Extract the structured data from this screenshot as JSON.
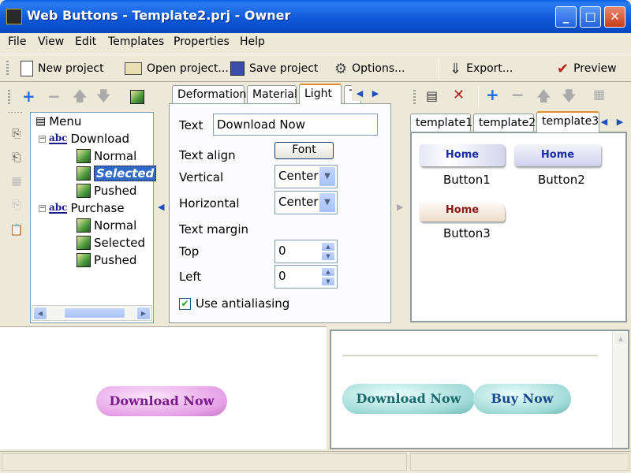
{
  "window": {
    "title": "Web Buttons - Template2.prj - Owner",
    "caption_min": "_",
    "caption_max": "□",
    "caption_close": "✕"
  },
  "menu": {
    "items": [
      "File",
      "View",
      "Edit",
      "Templates",
      "Properties",
      "Help"
    ]
  },
  "toolbar": {
    "new_project": "New project",
    "open_project": "Open project...",
    "save_project": "Save project",
    "options": "Options...",
    "export": "Export...",
    "preview": "Preview"
  },
  "tree": {
    "root": "Menu",
    "groups": [
      {
        "label": "Download",
        "children": [
          "Normal",
          "Selected",
          "Pushed"
        ]
      },
      {
        "label": "Purchase",
        "children": [
          "Normal",
          "Selected",
          "Pushed"
        ]
      }
    ],
    "selected_index": "Selected"
  },
  "props_tabs": [
    "Deformation",
    "Material",
    "Light",
    "T"
  ],
  "props": {
    "text_label": "Text",
    "text_value": "Download Now",
    "text_align_label": "Text align",
    "font_button": "Font",
    "vertical_label": "Vertical",
    "vertical_value": "Center",
    "horizontal_label": "Horizontal",
    "horizontal_value": "Center",
    "margin_label": "Text margin",
    "top_label": "Top",
    "top_value": "0",
    "left_label": "Left",
    "left_value": "0",
    "antialias_label": "Use antialiasing",
    "antialias_checked": true
  },
  "template_tabs": [
    "template1",
    "template2",
    "template3"
  ],
  "templates": [
    {
      "button_text": "Home",
      "caption": "Button1"
    },
    {
      "button_text": "Home",
      "caption": "Button2"
    },
    {
      "button_text": "Home",
      "caption": "Button3"
    }
  ],
  "preview_left": {
    "button": "Download Now"
  },
  "preview_right": {
    "buttons": [
      "Download Now",
      "Buy Now"
    ]
  },
  "colors": {
    "title_blue": "#0d57d8",
    "pink_button": "#e6a0e6",
    "teal_button": "#9fd9d6"
  }
}
